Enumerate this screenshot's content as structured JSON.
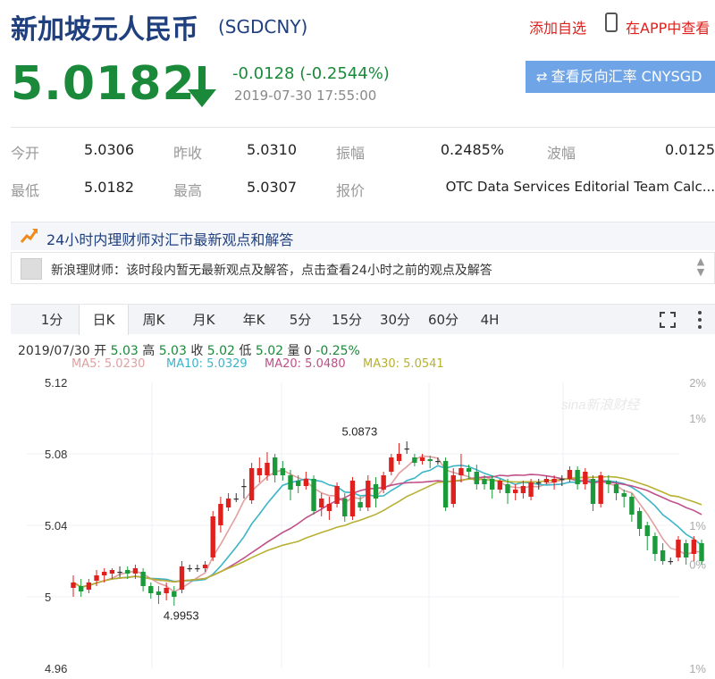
{
  "header": {
    "title": "新加坡元人民币",
    "code": "(SGDCNY)",
    "add_watch": "添加自选",
    "app_view": "在APP中查看"
  },
  "quote": {
    "price": "5.0182",
    "change": "-0.0128 (-0.2544%)",
    "timestamp": "2019-07-30 17:55:00",
    "reverse_button": "查看反向汇率 CNYSGD"
  },
  "stats": {
    "row1": [
      {
        "label": "今开",
        "value": "5.0306"
      },
      {
        "label": "昨收",
        "value": "5.0310"
      },
      {
        "label": "振幅",
        "value": "0.2485%"
      },
      {
        "label": "波幅",
        "value": "0.0125"
      }
    ],
    "row2": [
      {
        "label": "最低",
        "value": "5.0182"
      },
      {
        "label": "最高",
        "value": "5.0307"
      },
      {
        "label": "报价",
        "value": "OTC Data Services Editorial Team Calc..."
      }
    ]
  },
  "advisor": {
    "title": "24小时内理财师对汇市最新观点和解答",
    "notice": "新浪理财师：该时段内暂无最新观点及解答，点击查看24小时之前的观点及解答"
  },
  "tabs": [
    "1分",
    "日K",
    "周K",
    "月K",
    "年K",
    "5分",
    "15分",
    "30分",
    "60分",
    "4H"
  ],
  "ohlc": {
    "date": "2019/07/30",
    "open_label": "开",
    "open": "5.03",
    "high_label": "高",
    "high": "5.03",
    "close_label": "收",
    "close": "5.02",
    "low_label": "低",
    "low": "5.02",
    "vol_label": "量",
    "vol": "0",
    "pct": "-0.25%"
  },
  "ma": [
    {
      "label": "MA5: 5.0230",
      "color": "#e1a0a0"
    },
    {
      "label": "MA10: 5.0329",
      "color": "#3cb4c8"
    },
    {
      "label": "MA20: 5.0480",
      "color": "#c0508a"
    },
    {
      "label": "MA30: 5.0541",
      "color": "#b8b030"
    }
  ],
  "colors": {
    "up": "#e0201c",
    "down": "#1a9a3a",
    "brand": "#1f3f7f"
  },
  "watermark": "sina新浪财经",
  "chart_data": {
    "type": "candlestick",
    "y_ticks": [
      "5.12",
      "5.08",
      "5.04",
      "5",
      "4.96"
    ],
    "pct_ticks": [
      "2%",
      "1%",
      "1%",
      "0%",
      "1%"
    ],
    "ylim": [
      4.96,
      5.12
    ],
    "annotations": [
      {
        "text": "5.0873",
        "value": 5.0873,
        "index": 36
      },
      {
        "text": "4.9953",
        "value": 4.9953,
        "index": 13
      }
    ],
    "candles": [
      [
        5.005,
        5.008,
        5.0,
        5.012
      ],
      [
        5.006,
        5.003,
        5.0,
        5.01
      ],
      [
        5.004,
        5.008,
        5.002,
        5.01
      ],
      [
        5.009,
        5.012,
        5.006,
        5.015
      ],
      [
        5.012,
        5.014,
        5.008,
        5.016
      ],
      [
        5.013,
        5.015,
        5.01,
        5.016
      ],
      [
        5.014,
        5.014,
        5.011,
        5.017
      ],
      [
        5.015,
        5.013,
        5.01,
        5.017
      ],
      [
        5.013,
        5.016,
        5.01,
        5.018
      ],
      [
        5.014,
        5.006,
        5.003,
        5.016
      ],
      [
        5.006,
        5.002,
        4.999,
        5.008
      ],
      [
        5.003,
        5.001,
        4.996,
        5.006
      ],
      [
        5.002,
        5.005,
        4.998,
        5.008
      ],
      [
        5.003,
        5.0,
        4.995,
        5.006
      ],
      [
        5.004,
        5.017,
        5.002,
        5.02
      ],
      [
        5.016,
        5.016,
        5.014,
        5.018
      ],
      [
        5.016,
        5.016,
        5.014,
        5.018
      ],
      [
        5.016,
        5.018,
        5.014,
        5.02
      ],
      [
        5.022,
        5.045,
        5.02,
        5.048
      ],
      [
        5.04,
        5.052,
        5.036,
        5.056
      ],
      [
        5.05,
        5.055,
        5.048,
        5.058
      ],
      [
        5.055,
        5.055,
        5.053,
        5.058
      ],
      [
        5.062,
        5.062,
        5.055,
        5.066
      ],
      [
        5.054,
        5.072,
        5.052,
        5.075
      ],
      [
        5.068,
        5.072,
        5.064,
        5.078
      ],
      [
        5.068,
        5.075,
        5.065,
        5.081
      ],
      [
        5.078,
        5.068,
        5.064,
        5.08
      ],
      [
        5.072,
        5.068,
        5.065,
        5.076
      ],
      [
        5.068,
        5.06,
        5.054,
        5.071
      ],
      [
        5.065,
        5.062,
        5.058,
        5.068
      ],
      [
        5.062,
        5.066,
        5.06,
        5.07
      ],
      [
        5.066,
        5.048,
        5.046,
        5.068
      ],
      [
        5.05,
        5.055,
        5.045,
        5.058
      ],
      [
        5.048,
        5.052,
        5.043,
        5.056
      ],
      [
        5.052,
        5.062,
        5.05,
        5.064
      ],
      [
        5.055,
        5.045,
        5.042,
        5.058
      ],
      [
        5.045,
        5.065,
        5.043,
        5.067
      ],
      [
        5.053,
        5.05,
        5.048,
        5.056
      ],
      [
        5.05,
        5.065,
        5.048,
        5.068
      ],
      [
        5.063,
        5.055,
        5.05,
        5.067
      ],
      [
        5.06,
        5.068,
        5.058,
        5.07
      ],
      [
        5.07,
        5.078,
        5.068,
        5.08
      ],
      [
        5.076,
        5.08,
        5.074,
        5.086
      ],
      [
        5.083,
        5.083,
        5.08,
        5.087
      ],
      [
        5.078,
        5.075,
        5.073,
        5.08
      ],
      [
        5.076,
        5.078,
        5.074,
        5.08
      ],
      [
        5.077,
        5.076,
        5.072,
        5.079
      ],
      [
        5.076,
        5.076,
        5.074,
        5.078
      ],
      [
        5.076,
        5.05,
        5.048,
        5.078
      ],
      [
        5.052,
        5.068,
        5.05,
        5.072
      ],
      [
        5.068,
        5.072,
        5.064,
        5.08
      ],
      [
        5.072,
        5.07,
        5.066,
        5.074
      ],
      [
        5.07,
        5.063,
        5.06,
        5.074
      ],
      [
        5.066,
        5.063,
        5.06,
        5.068
      ],
      [
        5.066,
        5.06,
        5.055,
        5.068
      ],
      [
        5.06,
        5.065,
        5.058,
        5.066
      ],
      [
        5.063,
        5.058,
        5.052,
        5.066
      ],
      [
        5.058,
        5.06,
        5.054,
        5.063
      ],
      [
        5.058,
        5.062,
        5.055,
        5.065
      ],
      [
        5.056,
        5.064,
        5.054,
        5.066
      ],
      [
        5.064,
        5.064,
        5.06,
        5.066
      ],
      [
        5.064,
        5.066,
        5.063,
        5.068
      ],
      [
        5.064,
        5.066,
        5.06,
        5.068
      ],
      [
        5.066,
        5.066,
        5.062,
        5.068
      ],
      [
        5.066,
        5.071,
        5.064,
        5.073
      ],
      [
        5.071,
        5.063,
        5.06,
        5.073
      ],
      [
        5.063,
        5.07,
        5.06,
        5.072
      ],
      [
        5.066,
        5.052,
        5.048,
        5.068
      ],
      [
        5.052,
        5.068,
        5.05,
        5.07
      ],
      [
        5.065,
        5.063,
        5.058,
        5.068
      ],
      [
        5.063,
        5.058,
        5.054,
        5.065
      ],
      [
        5.058,
        5.056,
        5.05,
        5.06
      ],
      [
        5.056,
        5.046,
        5.042,
        5.058
      ],
      [
        5.048,
        5.038,
        5.034,
        5.05
      ],
      [
        5.04,
        5.034,
        5.026,
        5.042
      ],
      [
        5.034,
        5.024,
        5.02,
        5.036
      ],
      [
        5.026,
        5.02,
        5.018,
        5.03
      ],
      [
        5.02,
        5.02,
        5.018,
        5.022
      ],
      [
        5.022,
        5.032,
        5.02,
        5.034
      ],
      [
        5.03,
        5.022,
        5.018,
        5.032
      ],
      [
        5.024,
        5.032,
        5.02,
        5.034
      ],
      [
        5.03,
        5.02,
        5.018,
        5.032
      ]
    ]
  }
}
